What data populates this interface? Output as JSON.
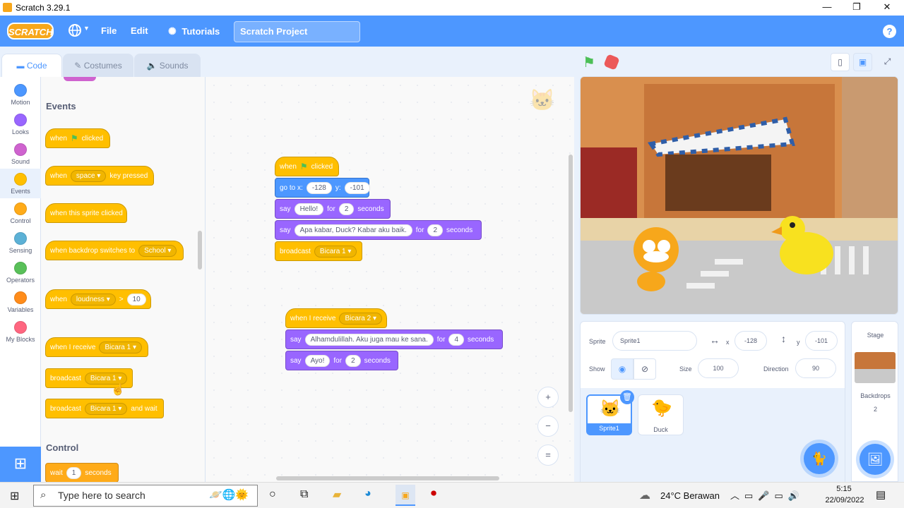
{
  "window": {
    "title": "Scratch 3.29.1",
    "controls": [
      "—",
      "❐",
      "✕"
    ]
  },
  "menu": {
    "logo": "SCRATCH",
    "language_icon": "globe-icon",
    "file": "File",
    "edit": "Edit",
    "tutorials": "Tutorials",
    "project_title": "Scratch Project",
    "help": "?"
  },
  "tabs": {
    "code": "Code",
    "costumes": "Costumes",
    "sounds": "Sounds"
  },
  "categories": [
    {
      "label": "Motion",
      "color": "#4c97ff"
    },
    {
      "label": "Looks",
      "color": "#9966ff"
    },
    {
      "label": "Sound",
      "color": "#cf63cf"
    },
    {
      "label": "Events",
      "color": "#ffbf00"
    },
    {
      "label": "Control",
      "color": "#ffab19"
    },
    {
      "label": "Sensing",
      "color": "#5cb1d6"
    },
    {
      "label": "Operators",
      "color": "#59c059"
    },
    {
      "label": "Variables",
      "color": "#ff8c1a"
    },
    {
      "label": "My Blocks",
      "color": "#ff6680"
    }
  ],
  "palette": {
    "events_heading": "Events",
    "control_heading": "Control",
    "when": "when",
    "clicked": "clicked",
    "space": "space",
    "key_pressed": "key pressed",
    "when_sprite_clicked": "when this sprite clicked",
    "when_backdrop": "when backdrop switches to",
    "school": "School",
    "loudness": "loudness",
    "gt": ">",
    "loud_val": "10",
    "when_i_receive": "when I receive",
    "bicara1": "Bicara 1",
    "broadcast": "broadcast",
    "and_wait": "and wait",
    "wait": "wait",
    "wait_val": "1",
    "seconds": "seconds"
  },
  "script1": {
    "when": "when",
    "clicked": "clicked",
    "goto": "go to x:",
    "x": "-128",
    "y_label": "y:",
    "y": "-101",
    "say": "say",
    "msg1": "Hello!",
    "for": "for",
    "t1": "2",
    "seconds": "seconds",
    "msg2": "Apa kabar, Duck? Kabar aku baik.",
    "t2": "2",
    "broadcast": "broadcast",
    "bcast": "Bicara 1"
  },
  "script2": {
    "when_receive": "when I receive",
    "msg": "Bicara 2",
    "say": "say",
    "msg1": "Alhamdulillah. Aku juga mau ke sana.",
    "for": "for",
    "t1": "4",
    "seconds": "seconds",
    "msg2": "Ayo!",
    "t2": "2"
  },
  "zoom": {
    "in": "+",
    "out": "−",
    "reset": "="
  },
  "sprite_info": {
    "sprite_label": "Sprite",
    "sprite_name": "Sprite1",
    "x_label": "x",
    "x": "-128",
    "y_label": "y",
    "y": "-101",
    "show_label": "Show",
    "size_label": "Size",
    "size": "100",
    "direction_label": "Direction",
    "direction": "90"
  },
  "sprites": [
    {
      "name": "Sprite1"
    },
    {
      "name": "Duck"
    }
  ],
  "stage_pane": {
    "title": "Stage",
    "backdrops_label": "Backdrops",
    "backdrops_count": "2"
  },
  "taskbar": {
    "search_placeholder": "Type here to search",
    "weather": "24°C Berawan",
    "time": "5:15",
    "date": "22/09/2022"
  }
}
